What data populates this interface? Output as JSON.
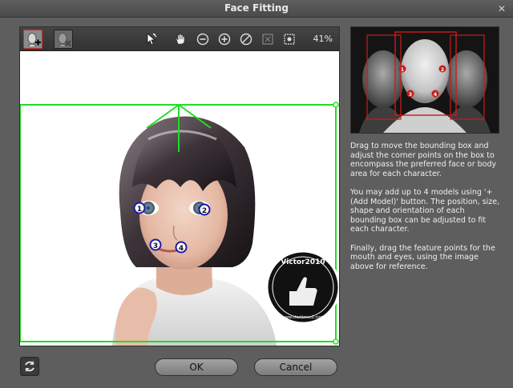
{
  "window": {
    "title": "Face Fitting"
  },
  "toolbar": {
    "zoom": "41%",
    "modes": [
      "add-model-icon",
      "remove-model-icon"
    ],
    "tools": [
      "select-pointer-icon",
      "pan-hand-icon",
      "zoom-out-icon",
      "zoom-in-icon",
      "reset-icon",
      "fit-icon",
      "fit-to-window-icon"
    ]
  },
  "viewer": {
    "feature_points": [
      "1",
      "2",
      "3",
      "4"
    ],
    "watermark": "Victor2010",
    "watermark_url": "www.startimes2.com"
  },
  "reference": {
    "feature_points": [
      "1",
      "2",
      "3",
      "4"
    ]
  },
  "help": {
    "paragraph_1": "Drag to move the bounding box and adjust the corner points on the box to encompass the preferred face or body area for each character.",
    "paragraph_2": "You may add up to 4 models using '+ (Add Model)' button. The position, size, shape and orientation of each bounding box can be adjusted to fit each character.",
    "paragraph_3": "Finally, drag the feature points for the mouth and eyes, using the image above for reference."
  },
  "buttons": {
    "ok": "OK",
    "cancel": "Cancel"
  },
  "colors": {
    "bounding_box": "#22dd22",
    "feature_point": "#1a1aaa",
    "reference_box": "#cc1a1a"
  }
}
